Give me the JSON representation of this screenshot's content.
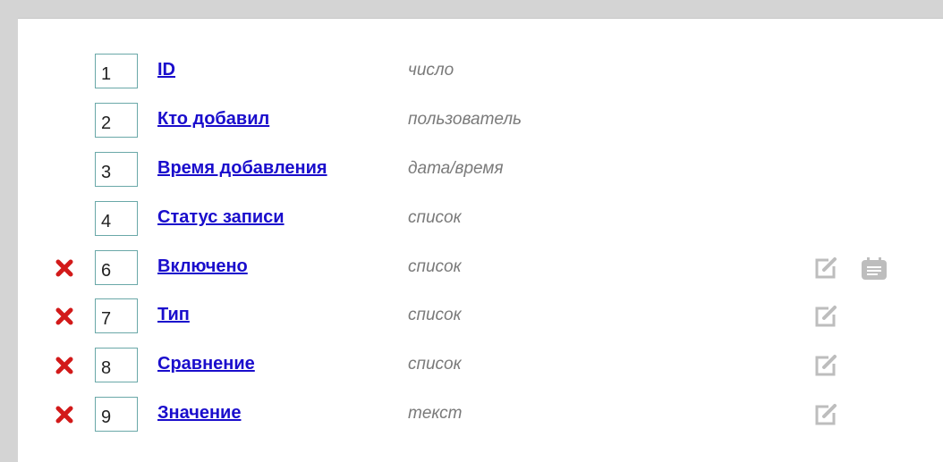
{
  "fields": [
    {
      "num": "1",
      "name": "ID",
      "type": "число",
      "deletable": false,
      "editable": false,
      "notes": false
    },
    {
      "num": "2",
      "name": "Кто добавил",
      "type": "пользователь",
      "deletable": false,
      "editable": false,
      "notes": false
    },
    {
      "num": "3",
      "name": "Время добавления",
      "type": "дата/время",
      "deletable": false,
      "editable": false,
      "notes": false
    },
    {
      "num": "4",
      "name": "Статус записи",
      "type": "список",
      "deletable": false,
      "editable": false,
      "notes": false
    },
    {
      "num": "6",
      "name": "Включено",
      "type": "список",
      "deletable": true,
      "editable": true,
      "notes": true
    },
    {
      "num": "7",
      "name": "Тип",
      "type": "список",
      "deletable": true,
      "editable": true,
      "notes": false
    },
    {
      "num": "8",
      "name": "Сравнение",
      "type": "список",
      "deletable": true,
      "editable": true,
      "notes": false
    },
    {
      "num": "9",
      "name": "Значение",
      "type": "текст",
      "deletable": true,
      "editable": true,
      "notes": false
    }
  ],
  "icons": {
    "delete": "delete-icon",
    "edit": "edit-icon",
    "notes": "notes-icon"
  },
  "colors": {
    "link": "#1a0dcc",
    "type_text": "#7a7a7a",
    "delete_red": "#d21a1a",
    "icon_gray": "#bdbdbd",
    "input_border": "#6aa8a8",
    "frame": "#d4d4d4"
  }
}
